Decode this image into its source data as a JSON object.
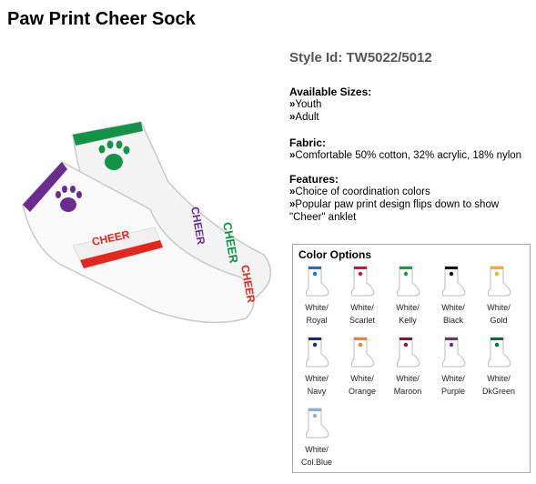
{
  "product": {
    "title": "Paw Print Cheer Sock",
    "style_id": "Style Id: TW5022/5012",
    "image_text": "CHEER"
  },
  "sizes": {
    "heading": "Available Sizes:",
    "items": [
      "Youth",
      "Adult"
    ]
  },
  "fabric": {
    "heading": "Fabric:",
    "items": [
      "Comfortable 50% cotton, 32% acrylic, 18% nylon"
    ]
  },
  "features": {
    "heading": "Features:",
    "items": [
      "Choice of coordination colors",
      "Popular paw print design flips down to show \"Cheer\" anklet"
    ]
  },
  "bullet": "»",
  "color_options": {
    "heading": "Color Options",
    "swatches": [
      {
        "line1": "White/",
        "line2": "Royal",
        "color": "#1e73be"
      },
      {
        "line1": "White/",
        "line2": "Scarlet",
        "color": "#d0113b"
      },
      {
        "line1": "White/",
        "line2": "Kelly",
        "color": "#13a04a"
      },
      {
        "line1": "White/",
        "line2": "Black",
        "color": "#111111"
      },
      {
        "line1": "White/",
        "line2": "Gold",
        "color": "#f2b318"
      },
      {
        "line1": "White/",
        "line2": "Navy",
        "color": "#1b2a6b"
      },
      {
        "line1": "White/",
        "line2": "Orange",
        "color": "#f58220"
      },
      {
        "line1": "White/",
        "line2": "Maroon",
        "color": "#8a1538"
      },
      {
        "line1": "White/",
        "line2": "Purple",
        "color": "#6a2c91"
      },
      {
        "line1": "White/",
        "line2": "DkGreen",
        "color": "#0b6b3a"
      },
      {
        "line1": "White/",
        "line2": "Col.Blue",
        "color": "#7fb2e5"
      }
    ]
  }
}
